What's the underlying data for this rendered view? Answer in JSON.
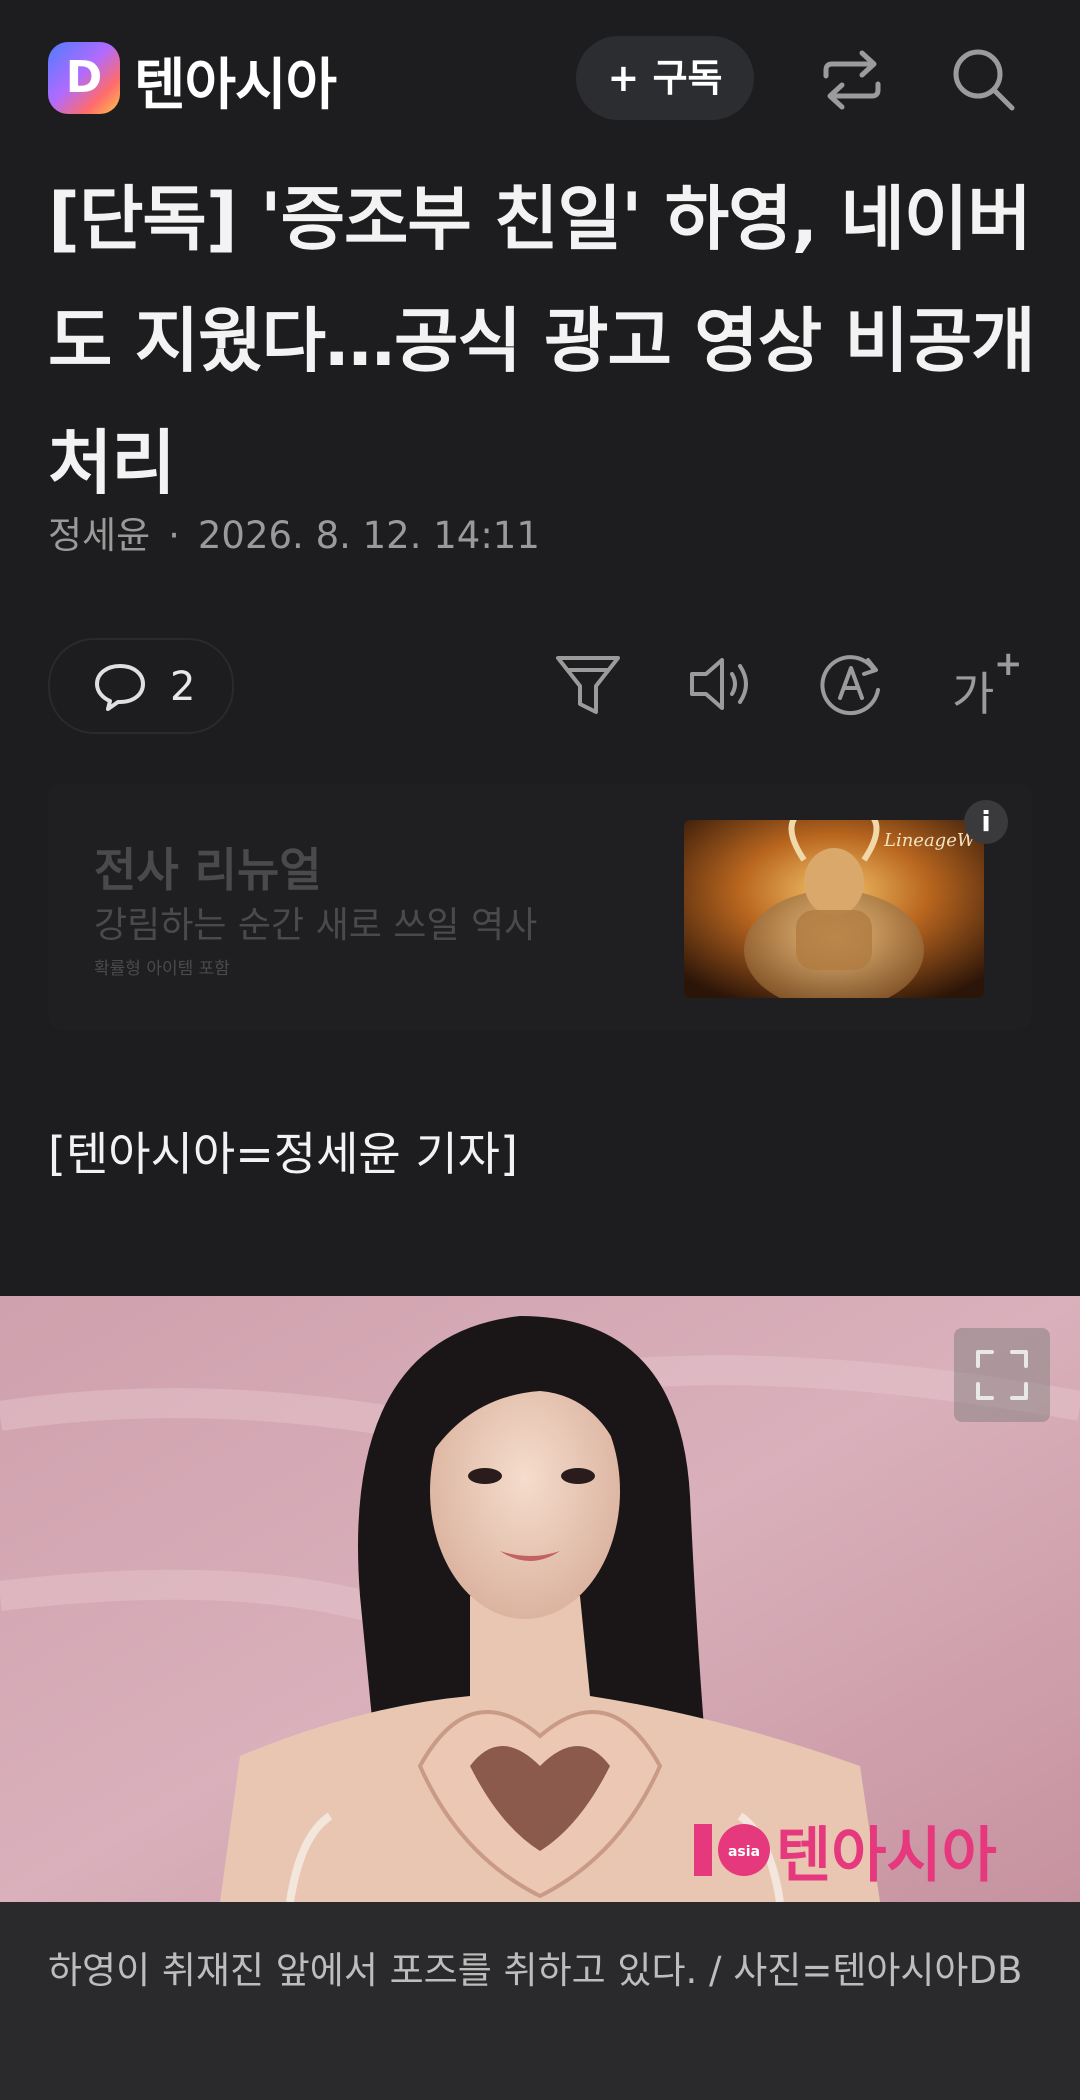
{
  "header": {
    "logo_letter": "D",
    "brand": "텐아시아",
    "subscribe_label": "+ 구독",
    "icons": [
      "share-icon",
      "search-icon"
    ]
  },
  "article": {
    "headline": "[단독] '증조부 친일' 하영, 네이버도 지웠다…공식 광고 영상 비공개 처리",
    "author": "정세윤",
    "separator": "·",
    "date": "2026. 8. 12. 14:11",
    "comment_count": "2",
    "toolbar_icons": [
      "comment-icon",
      "filter-icon",
      "speaker-icon",
      "translate-icon",
      "font-size-icon"
    ],
    "font_size_label": "가",
    "reporter_line": "[텐아시아=정세윤 기자]",
    "caption": "하영이 취재진 앞에서 포즈를 취하고 있다. / 사진=텐아시아DB"
  },
  "ad": {
    "title": "전사 리뉴얼",
    "subtitle": "강림하는 순간 새로 쓰일 역사",
    "fine_print": "확률형 아이템 포함",
    "image_label": "LineageW",
    "info_label": "i"
  },
  "photo": {
    "watermark_number": "10",
    "watermark_asia": "asia",
    "watermark_brand": "텐아시아"
  },
  "colors": {
    "background": "#1d1d1f",
    "caption_background": "#2a2a2c",
    "photo_pink": "#d9a9b6",
    "watermark": "#e5387d"
  }
}
